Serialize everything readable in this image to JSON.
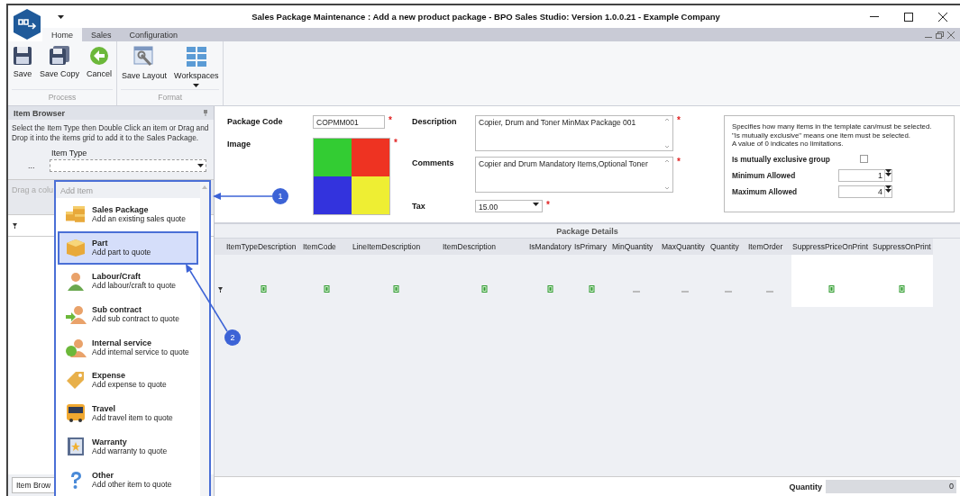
{
  "window": {
    "title": "Sales Package Maintenance : Add a new product package - BPO Sales Studio: Version 1.0.0.21 - Example Company"
  },
  "ribbon_tabs": [
    {
      "label": "Home",
      "selected": true
    },
    {
      "label": "Sales",
      "selected": false
    },
    {
      "label": "Configuration",
      "selected": false
    }
  ],
  "ribbon_groups": [
    {
      "label": "Process",
      "buttons": [
        {
          "label": "Save",
          "kind": "save",
          "dropdown": false
        },
        {
          "label": "Save Copy",
          "kind": "save-copy",
          "dropdown": false
        },
        {
          "label": "Cancel",
          "kind": "cancel",
          "dropdown": false
        }
      ]
    },
    {
      "label": "Format",
      "buttons": [
        {
          "label": "Save Layout",
          "kind": "layout",
          "dropdown": false
        },
        {
          "label": "Workspaces",
          "kind": "workspaces",
          "dropdown": true
        }
      ]
    }
  ],
  "item_browser": {
    "title": "Item Browser",
    "instructions": "Select the Item Type then Double Click an item or Drag and Drop it into the items grid to add it to the Sales Package.",
    "item_type_label": "Item Type",
    "ellipsis": "...",
    "group_hint": "Drag a colu",
    "bottom_tab": "Item Brow"
  },
  "add_item_menu": {
    "header": "Add Item",
    "items": [
      {
        "name": "Sales Package",
        "description": "Add an existing sales quote",
        "kind": "boxes",
        "selected": false
      },
      {
        "name": "Part",
        "description": "Add part to quote",
        "kind": "box",
        "selected": true
      },
      {
        "name": "Labour/Craft",
        "description": "Add labour/craft to quote",
        "kind": "person",
        "selected": false
      },
      {
        "name": "Sub contract",
        "description": "Add sub contract to quote",
        "kind": "person-arrow",
        "selected": false
      },
      {
        "name": "Internal service",
        "description": "Add internal service to quote",
        "kind": "person-cycle",
        "selected": false
      },
      {
        "name": "Expense",
        "description": "Add expense to quote",
        "kind": "tag",
        "selected": false
      },
      {
        "name": "Travel",
        "description": "Add travel item to quote",
        "kind": "bus",
        "selected": false
      },
      {
        "name": "Warranty",
        "description": "Add warranty to quote",
        "kind": "book",
        "selected": false
      },
      {
        "name": "Other",
        "description": "Add other item to quote",
        "kind": "question",
        "selected": false
      }
    ]
  },
  "form": {
    "package_code": {
      "label": "Package Code",
      "value": "COPMM001",
      "required_mark": "*"
    },
    "image": {
      "label": "Image",
      "required_mark": "*"
    },
    "description": {
      "label": "Description",
      "value": "Copier, Drum and Toner MinMax Package 001",
      "required_mark": "*"
    },
    "comments": {
      "label": "Comments",
      "value": "Copier and Drum Mandatory Items,Optional Toner",
      "required_mark": "*"
    },
    "tax": {
      "label": "Tax",
      "value": "15.00",
      "required_mark": "*"
    }
  },
  "selection_rules": {
    "note_lines": [
      "Specifies how many items in the template can/must be selected.",
      "\"Is mutually exclusive\" means one item must be selected.",
      "A value of 0 indicates no limitations."
    ],
    "exclusive": {
      "label": "Is mutually exclusive group",
      "checked": false
    },
    "minimum": {
      "label": "Minimum Allowed",
      "value": "1"
    },
    "maximum": {
      "label": "Maximum Allowed",
      "value": "4"
    }
  },
  "package_details": {
    "title": "Package Details",
    "columns": [
      {
        "label": "ItemTypeDescription",
        "kind": "check",
        "highlighted": false
      },
      {
        "label": "ItemCode",
        "kind": "check",
        "highlighted": false
      },
      {
        "label": "LineItemDescription",
        "kind": "check",
        "highlighted": false
      },
      {
        "label": "ItemDescription",
        "kind": "check",
        "highlighted": false
      },
      {
        "label": "IsMandatory",
        "kind": "check",
        "highlighted": false
      },
      {
        "label": "IsPrimary",
        "kind": "check",
        "highlighted": false
      },
      {
        "label": "MinQuantity",
        "kind": "dash",
        "highlighted": false
      },
      {
        "label": "MaxQuantity",
        "kind": "dash",
        "highlighted": false
      },
      {
        "label": "Quantity",
        "kind": "dash",
        "highlighted": false
      },
      {
        "label": "ItemOrder",
        "kind": "dash",
        "highlighted": false
      },
      {
        "label": "SuppressPriceOnPrint",
        "kind": "check",
        "highlighted": true
      },
      {
        "label": "SuppressOnPrint",
        "kind": "check",
        "highlighted": true
      }
    ]
  },
  "footer": {
    "label": "Quantity",
    "value": "0"
  },
  "callouts": [
    {
      "number": "1"
    },
    {
      "number": "2"
    }
  ]
}
